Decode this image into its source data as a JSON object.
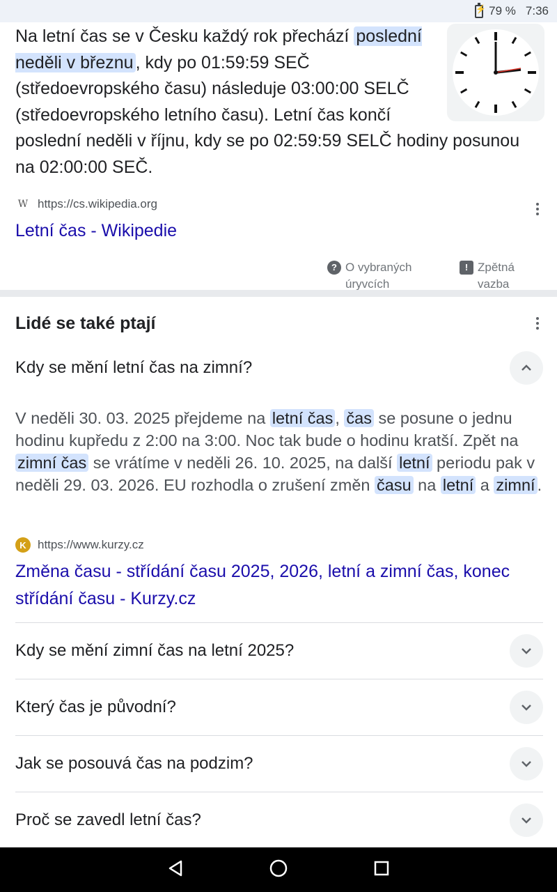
{
  "status": {
    "battery": "79 %",
    "time": "7:36"
  },
  "snippet": {
    "part1": "Na letní čas se v Česku každý rok přechází ",
    "highlight": "poslední neděli v březnu",
    "part2": ", kdy po 01:59:59 SEČ (středoevropského času) následuje 03:00:00 SELČ (středoevropského letního času). Letní čas končí poslední neděli v říjnu, kdy se po 02:59:59 SELČ hodiny posunou na 02:00:00 SEČ."
  },
  "source1": {
    "favicon": "W",
    "url": "https://cs.wikipedia.org",
    "title": "Letní čas - Wikipedie"
  },
  "footer": {
    "about": "O vybraných úryvcích",
    "feedback": "Zpětná vazba"
  },
  "paa": {
    "title": "Lidé se také ptají",
    "expanded_question": "Kdy se mění letní čas na zimní?",
    "answer": {
      "t1": "V neděli 30. 03. 2025 přejdeme na ",
      "h1": "letní čas",
      "t2": ", ",
      "h2": "čas",
      "t3": " se posune o jednu hodinu kupředu z 2:00 na 3:00. Noc tak bude o hodinu kratší. Zpět na ",
      "h3": "zimní čas",
      "t4": " se vrátíme v neděli 26. 10. 2025, na další ",
      "h4": "letní",
      "t5": " periodu pak v neděli 29. 03. 2026. EU rozhodla o zrušení změn ",
      "h5": "času",
      "t6": " na ",
      "h6": "letní",
      "t7": " a ",
      "h7": "zimní",
      "t8": "."
    },
    "answer_source": {
      "favicon": "K",
      "url": "https://www.kurzy.cz",
      "title": "Změna času - střídání času 2025, 2026, letní a zimní čas, konec střídání času - Kurzy.cz"
    },
    "questions": [
      "Kdy se mění zimní čas na letní 2025?",
      "Který čas je původní?",
      "Jak se posouvá čas na podzim?",
      "Proč se zavedl letní čas?"
    ]
  }
}
